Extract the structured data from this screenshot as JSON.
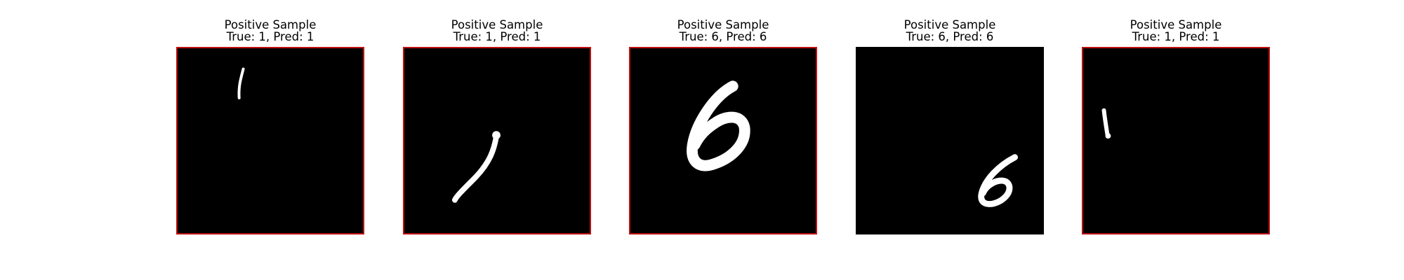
{
  "samples": [
    {
      "label": "Positive Sample",
      "caption": "True: 1, Pred: 1",
      "digit_icon": "digit-one-icon"
    },
    {
      "label": "Positive Sample",
      "caption": "True: 1, Pred: 1",
      "digit_icon": "digit-one-icon"
    },
    {
      "label": "Positive Sample",
      "caption": "True: 6, Pred: 6",
      "digit_icon": "digit-six-icon"
    },
    {
      "label": "Positive Sample",
      "caption": "True: 6, Pred: 6",
      "digit_icon": "digit-six-icon"
    },
    {
      "label": "Positive Sample",
      "caption": "True: 1, Pred: 1",
      "digit_icon": "digit-one-icon"
    }
  ],
  "colors": {
    "frame_border": "#c01010",
    "image_background": "#000000",
    "digit_stroke": "#ffffff"
  }
}
